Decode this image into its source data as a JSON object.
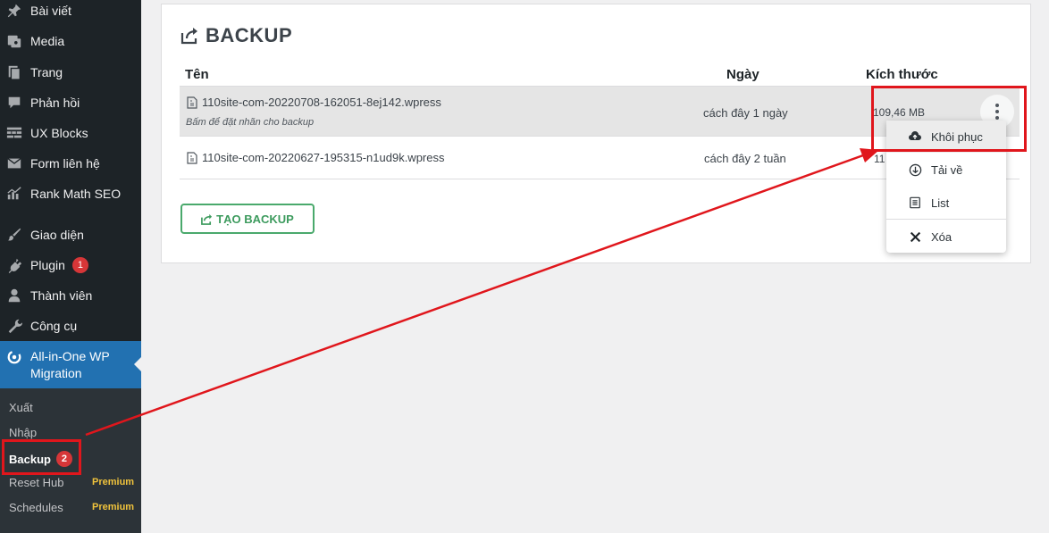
{
  "sidebar": {
    "items": [
      {
        "label": "Bài viết",
        "icon": "pin-icon"
      },
      {
        "label": "Media",
        "icon": "media-icon"
      },
      {
        "label": "Trang",
        "icon": "pages-icon"
      },
      {
        "label": "Phản hồi",
        "icon": "comment-icon"
      },
      {
        "label": "UX Blocks",
        "icon": "blocks-icon"
      },
      {
        "label": "Form liên hệ",
        "icon": "mail-icon"
      },
      {
        "label": "Rank Math SEO",
        "icon": "chart-icon"
      },
      {
        "label": "Giao diện",
        "icon": "brush-icon"
      },
      {
        "label": "Plugin",
        "icon": "plugin-icon",
        "badge": "1"
      },
      {
        "label": "Thành viên",
        "icon": "user-icon"
      },
      {
        "label": "Công cụ",
        "icon": "wrench-icon"
      }
    ],
    "active": {
      "label_line1": "All-in-One WP",
      "label_line2": "Migration",
      "icon": "migration-icon"
    },
    "submenu": [
      {
        "label": "Xuất"
      },
      {
        "label": "Nhập"
      },
      {
        "label": "Backup",
        "badge": "2",
        "current": true
      },
      {
        "label": "Reset Hub",
        "tag": "Premium"
      },
      {
        "label": "Schedules",
        "tag": "Premium"
      }
    ]
  },
  "panel": {
    "title": "BACKUP",
    "columns": {
      "name": "Tên",
      "date": "Ngày",
      "size": "Kích thước"
    },
    "rows": [
      {
        "file": "110site-com-20220708-162051-8ej142.wpress",
        "note": "Bấm để đặt nhãn cho backup",
        "date": "cách đây 1 ngày",
        "size": "109,46 MB"
      },
      {
        "file": "110site-com-20220627-195315-n1ud9k.wpress",
        "date": "cách đây 2 tuần",
        "size": "11"
      }
    ],
    "create_button": "TẠO BACKUP"
  },
  "dropdown": {
    "items": [
      {
        "label": "Khôi phục",
        "icon": "cloud-restore-icon"
      },
      {
        "label": "Tải về",
        "icon": "download-icon"
      },
      {
        "label": "List",
        "icon": "list-icon"
      },
      {
        "label": "Xóa",
        "icon": "close-icon"
      }
    ]
  },
  "colors": {
    "annotation": "#e0161c",
    "sidebar_bg": "#1d2327",
    "active_bg": "#2271b1",
    "button_green": "#3d9b5e",
    "badge": "#d63638",
    "premium": "#f0c33c"
  }
}
